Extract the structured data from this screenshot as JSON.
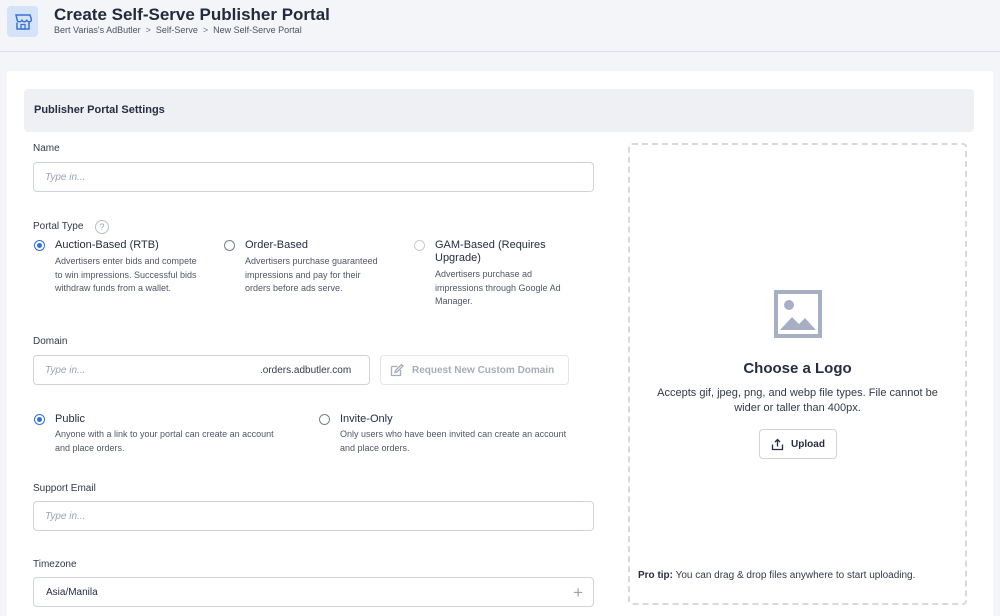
{
  "header": {
    "title": "Create Self-Serve Publisher Portal",
    "breadcrumb": [
      "Bert Varias's AdButler",
      "Self-Serve",
      "New Self-Serve Portal"
    ],
    "separator": ">",
    "icon": "storefront-icon"
  },
  "section": {
    "title": "Publisher Portal Settings"
  },
  "name_field": {
    "label": "Name",
    "placeholder": "Type in..."
  },
  "portal_type": {
    "label": "Portal Type",
    "help": "?",
    "options": [
      {
        "title": "Auction-Based (RTB)",
        "desc": [
          "Advertisers enter bids and compete",
          "to win impressions. Successful bids",
          "withdraw funds from a wallet."
        ],
        "checked": true
      },
      {
        "title": "Order-Based",
        "desc": [
          "Advertisers purchase guaranteed",
          "impressions and pay for their",
          "orders before ads serve."
        ],
        "checked": false
      },
      {
        "title_lines": [
          "GAM-Based (Requires",
          "Upgrade)"
        ],
        "desc": [
          "Advertisers purchase ad",
          "impressions through Google Ad",
          "Manager."
        ],
        "checked": false,
        "disabled": true
      }
    ]
  },
  "domain": {
    "label": "Domain",
    "placeholder": "Type in...",
    "suffix": ".orders.adbutler.com",
    "request_button": "Request New Custom Domain"
  },
  "access": {
    "options": [
      {
        "title": "Public",
        "desc": [
          "Anyone with a link to your portal can create an account",
          "and place orders."
        ],
        "checked": true
      },
      {
        "title": "Invite-Only",
        "desc": [
          "Only users who have been invited can create an account",
          "and place orders."
        ],
        "checked": false
      }
    ]
  },
  "support_email": {
    "label": "Support Email",
    "placeholder": "Type in..."
  },
  "timezone": {
    "label": "Timezone",
    "value": "Asia/Manila",
    "expand": "+"
  },
  "logo": {
    "title": "Choose a Logo",
    "desc": [
      "Accepts gif, jpeg, png, and webp file types. File cannot be",
      "wider or taller than 400px."
    ],
    "upload_label": "Upload",
    "protip_label": "Pro tip:",
    "protip_text": "You can drag & drop files anywhere to start uploading."
  },
  "colors": {
    "accent": "#2f6fe0",
    "icon_bg": "#d5e3f8",
    "image_icon": "#a7b0c2"
  }
}
